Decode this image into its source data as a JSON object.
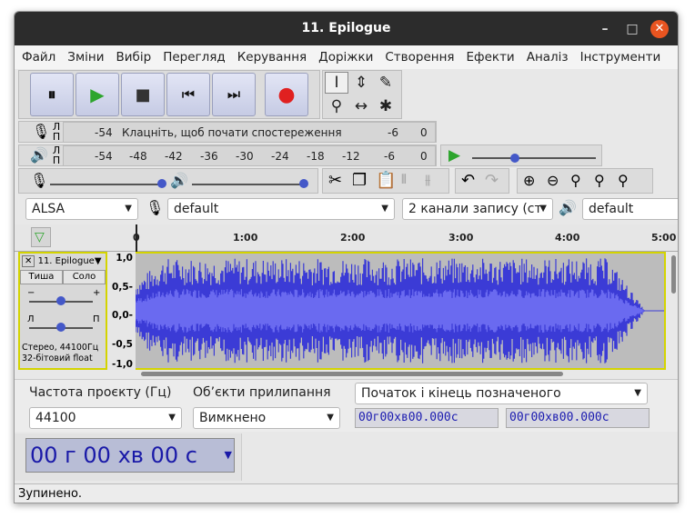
{
  "window": {
    "title": "11. Epilogue",
    "minimize": "–",
    "maximize": "□",
    "close": "✕"
  },
  "menu": [
    "Файл",
    "Зміни",
    "Вибір",
    "Перегляд",
    "Керування",
    "Доріжки",
    "Створення",
    "Ефекти",
    "Аналіз",
    "Інструменти"
  ],
  "transport": {
    "pause": "⏸",
    "play": "▶",
    "stop": "■",
    "skip_start": "⏮",
    "skip_end": "⏭",
    "record": "●"
  },
  "meters": {
    "record": {
      "l": "Л",
      "p": "П",
      "scale_left": "-54",
      "prompt": "Клацніть, щоб почати спостереження",
      "scale_right": [
        "-6",
        "0"
      ]
    },
    "playback": {
      "l": "Л",
      "p": "П",
      "scale": [
        "-54",
        "-48",
        "-42",
        "-36",
        "-30",
        "-24",
        "-18",
        "-12",
        "-6",
        "0"
      ]
    }
  },
  "device": {
    "host": "ALSA",
    "rec_device": "default",
    "channels": "2 канали запису (ст",
    "play_device": "default"
  },
  "ruler": {
    "ticks": [
      "0",
      "1:00",
      "2:00",
      "3:00",
      "4:00",
      "5:00"
    ]
  },
  "track": {
    "name": "11. Epilogue",
    "mute": "Тиша",
    "solo": "Соло",
    "gain_minus": "−",
    "gain_plus": "+",
    "pan_l": "Л",
    "pan_r": "П",
    "info1": "Стерео, 44100Гц",
    "info2": "32-бітовий float",
    "y_labels": [
      "1,0",
      "0,5-",
      "0,0-",
      "-0,5",
      "-1,0"
    ]
  },
  "selection": {
    "rate_label": "Частота проєкту (Гц)",
    "rate_value": "44100",
    "snap_label": "Об’єкти прилипання",
    "snap_value": "Вимкнено",
    "sel_mode": "Початок і кінець позначеного",
    "start_time": "00г00хв00.000с",
    "end_time": "00г00хв00.000с"
  },
  "clock": {
    "value": "00 г 00 хв 00 с"
  },
  "status": {
    "text": "Зупинено."
  },
  "colors": {
    "wave": "#3b3bd6",
    "wave_bg": "#bcbcbc",
    "accent": "#e95420"
  }
}
